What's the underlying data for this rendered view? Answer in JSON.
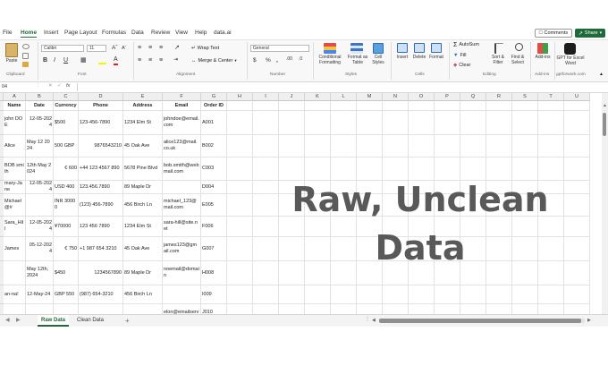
{
  "menu": {
    "items": [
      "File",
      "Home",
      "Insert",
      "Page Layout",
      "Formulas",
      "Data",
      "Review",
      "View",
      "Help",
      "data.ai"
    ],
    "comments": "Comments",
    "share": "Share"
  },
  "ribbon": {
    "paste": "Paste",
    "font_name": "Calibri",
    "font_size": "11",
    "wrap_text": "Wrap Text",
    "merge_center": "Merge & Center",
    "number_format": "General",
    "conditional_formatting": "Conditional\nFormatting",
    "format_as_table": "Format as\nTable",
    "cell_styles": "Cell\nStyles",
    "insert": "Insert",
    "delete": "Delete",
    "format": "Format",
    "autosum": "AutoSum",
    "fill": "Fill",
    "clear": "Clear",
    "sort_filter": "Sort &\nFilter",
    "find_select": "Find &\nSelect",
    "addins": "Add-ins",
    "gpt": "GPT for\nExcel Word",
    "groups": {
      "clipboard": "Clipboard",
      "font": "Font",
      "alignment": "Alignment",
      "number": "Number",
      "styles": "Styles",
      "cells": "Cells",
      "editing": "Editing",
      "addins": "Add-ins",
      "gptworks": "gptforwork.com"
    }
  },
  "formula_bar": {
    "name_box": "04",
    "fx": "fx"
  },
  "columns": [
    "A",
    "B",
    "C",
    "D",
    "E",
    "F",
    "G",
    "H",
    "I",
    "J",
    "K",
    "L",
    "M",
    "N",
    "O",
    "P",
    "Q",
    "R",
    "S",
    "T",
    "U"
  ],
  "table": {
    "headers": [
      "Name",
      "Date",
      "Currency",
      "Phone",
      "Address",
      "Email",
      "Order ID"
    ],
    "rows": [
      [
        "john DOE",
        "12-05-2024",
        "$500",
        "123-456-7890",
        "1234 Elm St",
        "johndoe@email.com",
        "A001"
      ],
      [
        "Alice",
        "May 12 2024",
        "500 GBP",
        "9876543210",
        "45 Oak Ave",
        "alice123@mail.co.uk",
        "B002"
      ],
      [
        "BOB smith",
        "12th May 2024",
        "€ 600",
        "+44 123 4567 890",
        "5678 Pine Blvd",
        "bob.smith@webmail.com",
        "C003"
      ],
      [
        "mary-Jane",
        "12-05-2024",
        "USD 400",
        "123.456.7890",
        "89 Maple Dr",
        "",
        "D004"
      ],
      [
        "Michael @#",
        "",
        "INR 30000",
        "(123) 456-7890",
        "456 Birch Ln",
        "michael_123@mail.com",
        "E005"
      ],
      [
        "Sara_Hill",
        "12-05-2024",
        "¥70000",
        "123 456 7890",
        "1234 Elm St",
        "sara-hill@site.net",
        "F006"
      ],
      [
        "James",
        "05-12-2024",
        "€ 750",
        "+1 987 654 3210",
        "45 Oak Ave",
        "james123@gmail.com",
        "G007"
      ],
      [
        "",
        "May 12th, 2024",
        "$450",
        "1234567890",
        "89 Maple Dr",
        "noemail@domain",
        "H008"
      ],
      [
        "an-na!",
        "12-May-24",
        "GBP 550",
        "(987) 654-3210",
        "456 Birch Ln",
        "",
        "I009"
      ],
      [
        "",
        "",
        "",
        "",
        "",
        "elon@emailserv",
        "J010"
      ]
    ]
  },
  "overlay": {
    "line1": "Raw, Unclean",
    "line2": "Data"
  },
  "sheets": {
    "tabs": [
      "Raw Data",
      "Clean Data"
    ],
    "add": "+"
  }
}
